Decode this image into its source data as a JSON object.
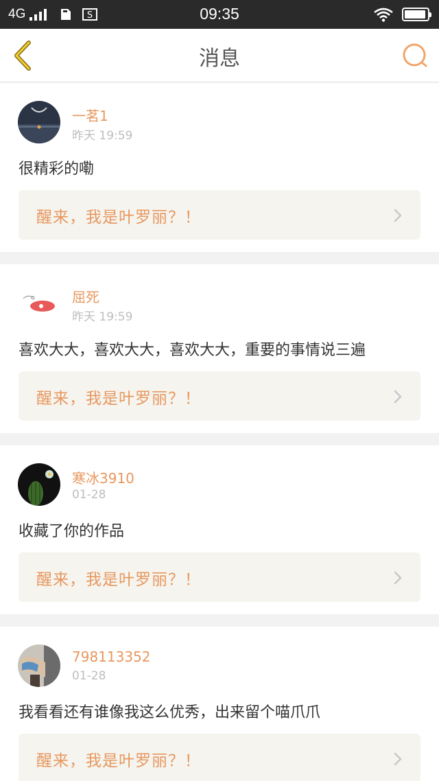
{
  "status_bar": {
    "network": "4G",
    "time": "09:35",
    "battery_level": 0.95
  },
  "nav": {
    "title": "消息"
  },
  "messages": [
    {
      "username": "一茗1",
      "time": "昨天 19:59",
      "text": "很精彩的嘞",
      "work_title": "醒来，我是叶罗丽？！"
    },
    {
      "username": "屈死",
      "time": "昨天 19:59",
      "text": "喜欢大大，喜欢大大，喜欢大大，重要的事情说三遍",
      "work_title": "醒来，我是叶罗丽？！"
    },
    {
      "username": "寒冰3910",
      "time": "01-28",
      "text": "收藏了你的作品",
      "work_title": "醒来，我是叶罗丽？！"
    },
    {
      "username": "798113352",
      "time": "01-28",
      "text": "我看看还有谁像我这么优秀，出来留个喵爪爪",
      "work_title": "醒来，我是叶罗丽？！"
    }
  ],
  "colors": {
    "accent": "#e8975e",
    "back_icon": "#e6c226",
    "card_bg": "#f5f4ef"
  }
}
